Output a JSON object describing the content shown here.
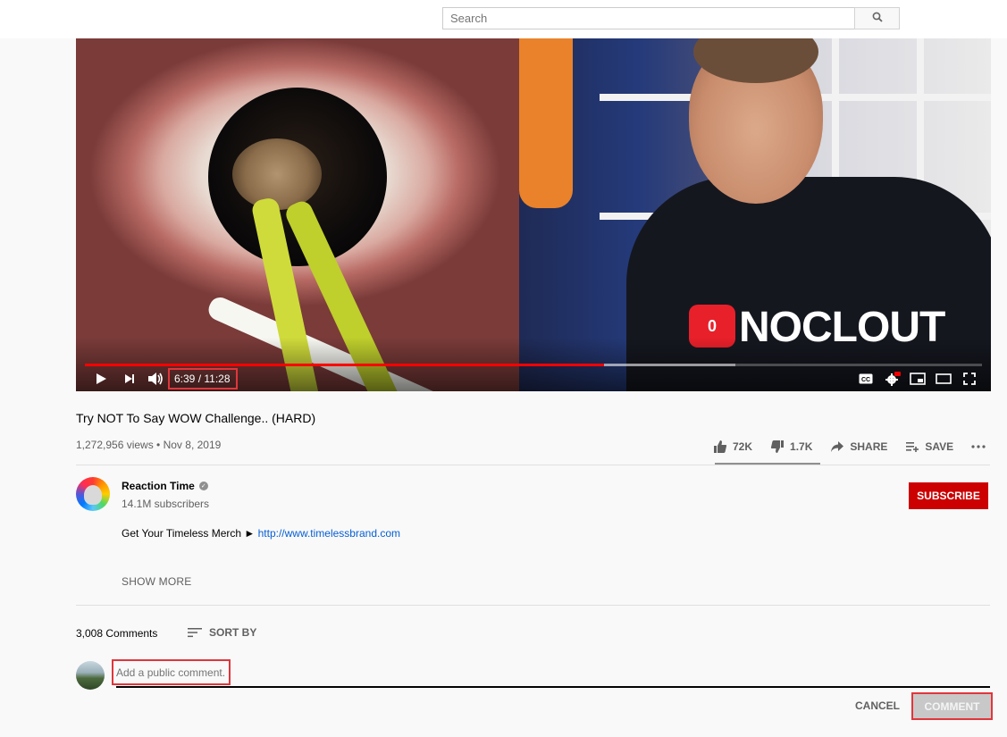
{
  "search": {
    "placeholder": "Search"
  },
  "player": {
    "current_time": "6:39",
    "duration": "11:28",
    "time_display": "6:39 / 11:28",
    "progress_fraction": 0.579,
    "buffer_fraction": 0.725,
    "overlay_brand": "NOCLOUT",
    "overlay_badge": "0"
  },
  "video": {
    "title": "Try NOT To Say WOW Challenge.. (HARD)",
    "meta": "1,272,956 views • Nov 8, 2019",
    "likes": "72K",
    "dislikes": "1.7K",
    "share_label": "SHARE",
    "save_label": "SAVE"
  },
  "channel": {
    "name": "Reaction Time",
    "subscribers": "14.1M subscribers",
    "subscribe_label": "SUBSCRIBE",
    "description_text": "Get Your Timeless Merch ► ",
    "description_link": "http://www.timelessbrand.com",
    "show_more": "SHOW MORE"
  },
  "comments": {
    "count": "3,008 Comments",
    "sort_label": "SORT BY",
    "input_placeholder": "Add a public comment...",
    "cancel_label": "CANCEL",
    "submit_label": "COMMENT"
  },
  "colors": {
    "accent": "#cc0000",
    "progress": "#ff0000",
    "highlight_box": "#e0363b",
    "link": "#065fd4"
  }
}
